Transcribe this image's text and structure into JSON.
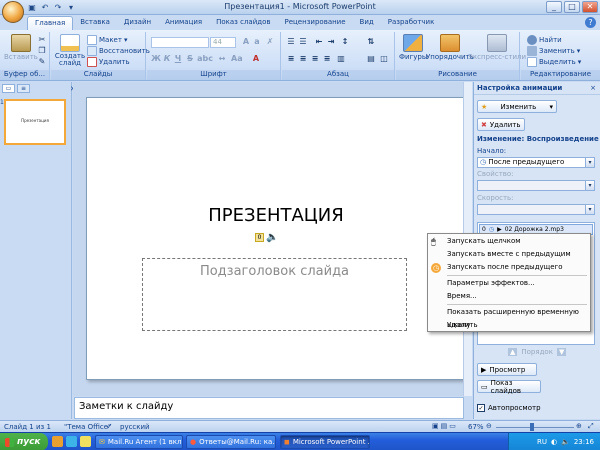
{
  "window": {
    "title": "Презентация1 - Microsoft PowerPoint",
    "min": "_",
    "max": "□",
    "close": "✕"
  },
  "tabs": [
    "Главная",
    "Вставка",
    "Дизайн",
    "Анимация",
    "Показ слайдов",
    "Рецензирование",
    "Вид",
    "Разработчик"
  ],
  "ribbon": {
    "paste": "Вставить",
    "new_slide": "Создать слайд",
    "layout": "Макет",
    "reset": "Восстановить",
    "delete": "Удалить",
    "font_size": "44",
    "bold": "Ж",
    "italic": "К",
    "underline": "Ч",
    "strike": "S",
    "shadow": "abc",
    "shapes": "Фигуры",
    "arrange": "Упорядочить",
    "quick_styles": "Экспресс-стили",
    "find": "Найти",
    "replace": "Заменить",
    "select": "Выделить",
    "groups": {
      "clipboard": "Буфер об...",
      "slides": "Слайды",
      "font": "Шрифт",
      "paragraph": "Абзац",
      "drawing": "Рисование",
      "editing": "Редактирование"
    }
  },
  "slide_thumbnail": {
    "number": "1",
    "title": "Презентация"
  },
  "slide": {
    "title": "ПРЕЗЕНТАЦИЯ",
    "badge": "0",
    "subtitle": "Подзаголовок слайда"
  },
  "notes": {
    "placeholder": "Заметки к слайду"
  },
  "task_pane": {
    "title": "Настройка анимации",
    "close": "×",
    "change_button": "Изменить",
    "remove_button": "Удалить",
    "change_label": "Изменение: Воспроизведение",
    "start_label": "Начало:",
    "start_value": "После предыдущего",
    "property_label": "Свойство:",
    "speed_label": "Скорость:",
    "anim_item": {
      "index": "0",
      "name": "02 Дорожка 2.mp3"
    },
    "order_label": "Порядок",
    "preview_button": "Просмотр",
    "slideshow_button": "Показ слайдов",
    "autopreview_label": "Автопросмотр"
  },
  "context_menu": {
    "items": [
      "Запускать щелчком",
      "Запускать вместе с предыдущим",
      "Запускать после предыдущего",
      "Параметры эффектов...",
      "Время...",
      "Показать расширенную временную шкалу",
      "Удалить"
    ]
  },
  "status": {
    "slide": "Слайд 1 из 1",
    "theme": "\"Тема Office\"",
    "language": "русский",
    "zoom": "67%"
  },
  "taskbar": {
    "start": "пуск",
    "buttons": [
      "Mail.Ru Агент (1 вкл...",
      "Ответы@Mail.Ru: ка...",
      "Microsoft PowerPoint ..."
    ],
    "lang": "RU",
    "clock": "23:16"
  },
  "colors": {
    "ribbon": "#cfe0f7",
    "accent": "#15428b",
    "menu_highlight": "#f5a83a"
  }
}
